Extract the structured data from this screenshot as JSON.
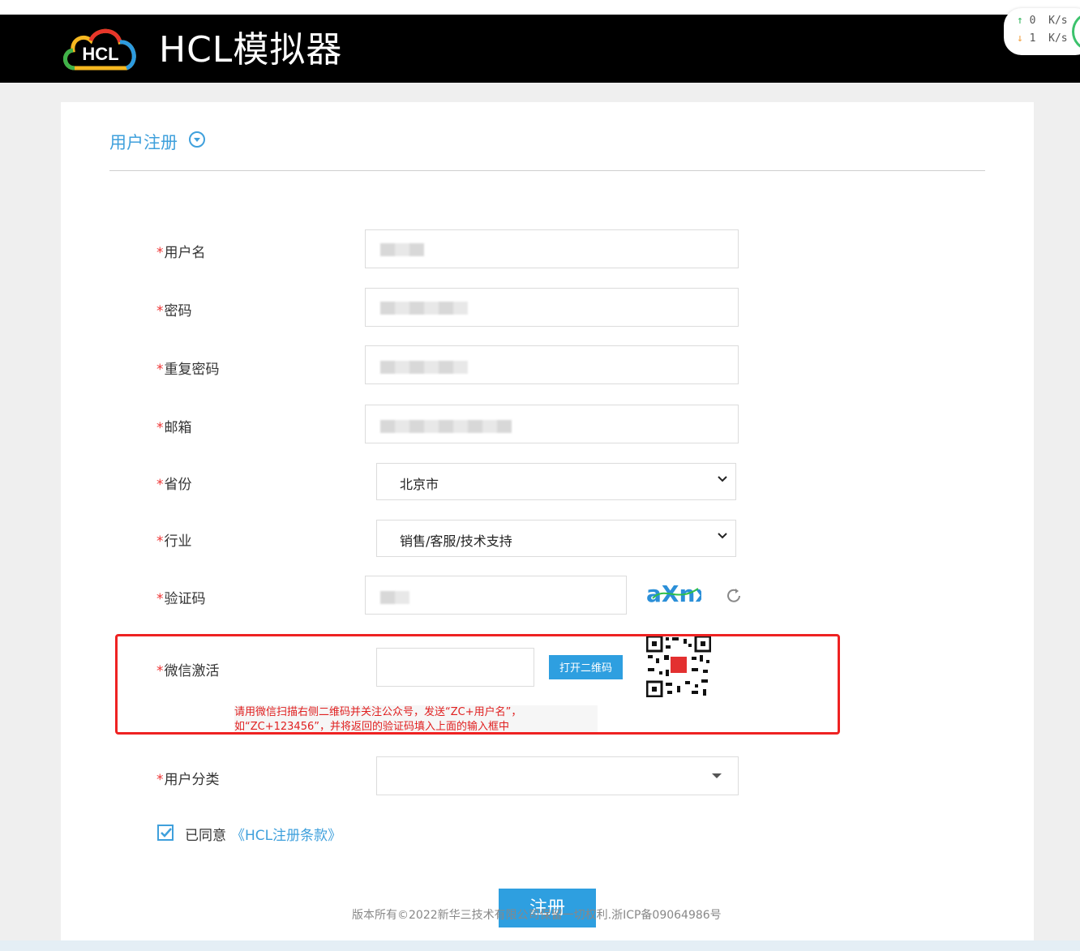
{
  "header": {
    "logo_text": "HCL",
    "app_title": "HCL模拟器"
  },
  "speed_widget": {
    "up_value": "0",
    "up_unit": "K/s",
    "down_value": "1",
    "down_unit": "K/s",
    "up_color": "#2fb45a",
    "down_color": "#f0a040"
  },
  "section": {
    "title": "用户注册",
    "accent_color": "#3fa0dc"
  },
  "form": {
    "required_mark": "*",
    "username_label": "用户名",
    "password_label": "密码",
    "repeat_password_label": "重复密码",
    "email_label": "邮箱",
    "province_label": "省份",
    "province_value": "北京市",
    "industry_label": "行业",
    "industry_value": "销售/客服/技术支持",
    "captcha_label": "验证码",
    "captcha_image_text": "aXnx",
    "wechat_label": "微信激活",
    "wechat_value": "",
    "open_qr_button": "打开二维码",
    "wechat_hint": "请用微信扫描右侧二维码并关注公众号，发送“ZC+用户名”， 如“ZC+123456”，并将返回的验证码填入上面的输入框中",
    "user_type_label": "用户分类",
    "user_type_value": "",
    "agree_checked": true,
    "agree_text": "已同意",
    "terms_link": "《HCL注册条款》",
    "submit_button": "注册"
  },
  "footer": {
    "copyright": "版本所有©2022新华三技术有限公司保留一切权利.浙ICP备09064986号"
  },
  "colors": {
    "header_bg": "#000000",
    "button_blue": "#2e9fe0",
    "highlight_red": "#ee2222",
    "required_red": "#ee3333"
  }
}
